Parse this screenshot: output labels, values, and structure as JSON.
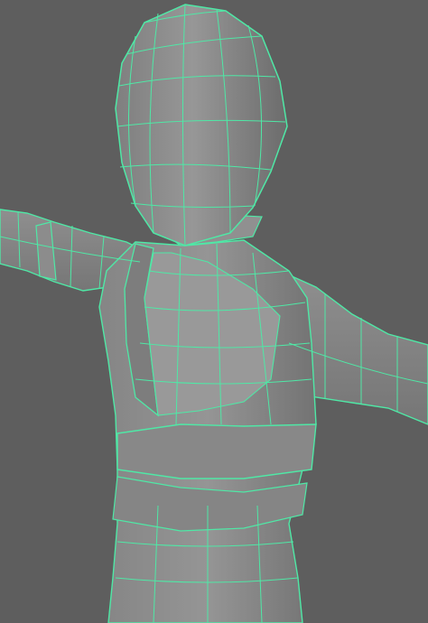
{
  "viewport": {
    "background_color": "#5e5e5e",
    "mesh_fill_color": "#8a8a8a",
    "wireframe_color": "#4fe8a6",
    "selection_state": "selected"
  }
}
